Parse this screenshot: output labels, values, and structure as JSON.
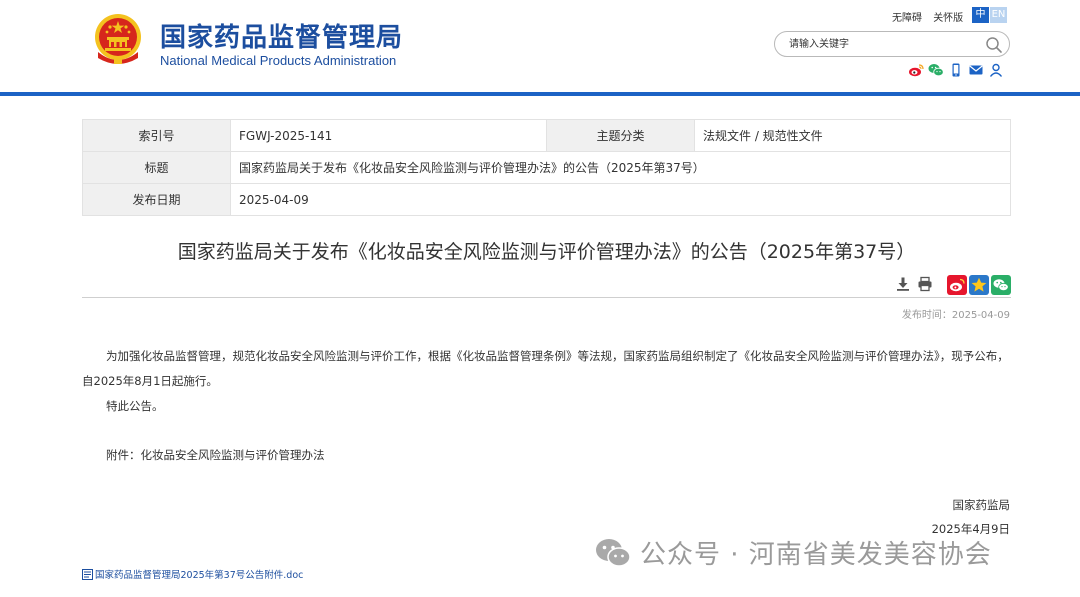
{
  "header": {
    "site_title_cn": "国家药品监督管理局",
    "site_title_en": "National Medical Products Administration",
    "accessibility": "无障碍",
    "care_version": "关怀版",
    "lang_cn": "中",
    "lang_en": "EN",
    "search_placeholder": "请输入关键字",
    "brand_color": "#1c4e9f",
    "accent_color": "#1c63c5"
  },
  "meta": {
    "index_label": "索引号",
    "index_value": "FGWJ-2025-141",
    "category_label": "主题分类",
    "category_value": "法规文件 / 规范性文件",
    "title_label": "标题",
    "title_value": "国家药监局关于发布《化妆品安全风险监测与评价管理办法》的公告（2025年第37号）",
    "date_label": "发布日期",
    "date_value": "2025-04-09"
  },
  "article": {
    "title": "国家药监局关于发布《化妆品安全风险监测与评价管理办法》的公告（2025年第37号）",
    "publish_time": "发布时间：2025-04-09",
    "paragraph1": "为加强化妆品监督管理，规范化妆品安全风险监测与评价工作，根据《化妆品监督管理条例》等法规，国家药监局组织制定了《化妆品安全风险监测与评价管理办法》，现予公布，自2025年8月1日起施行。",
    "paragraph2": "特此公告。",
    "attachment_note": "附件：化妆品安全风险监测与评价管理办法",
    "signature_org": "国家药监局",
    "signature_date": "2025年4月9日",
    "attachment_file": "国家药品监督管理局2025年第37号公告附件.doc"
  },
  "watermark": {
    "text": "公众号 · 河南省美发美容协会"
  },
  "icons": [
    "emblem-icon",
    "search-icon",
    "weibo-icon",
    "wechat-icon",
    "mobile-icon",
    "mail-icon",
    "user-icon",
    "download-icon",
    "print-icon",
    "share-weibo-icon",
    "share-qzone-icon",
    "share-wechat-icon",
    "doc-file-icon",
    "wechat-watermark-icon"
  ]
}
